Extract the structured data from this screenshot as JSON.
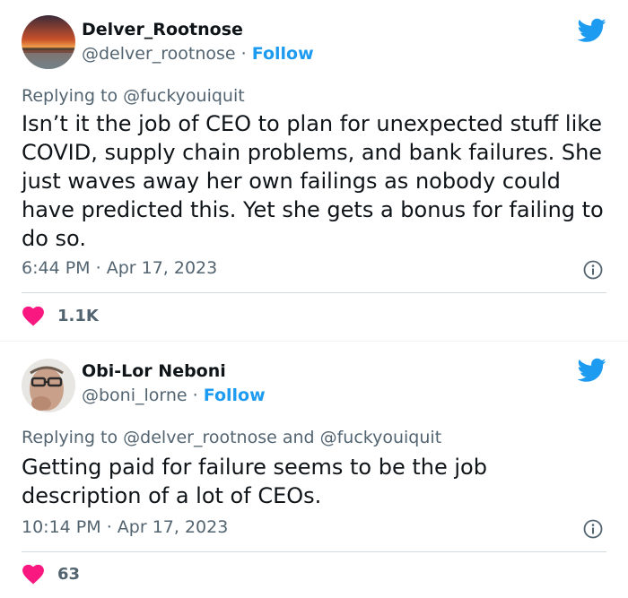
{
  "colors": {
    "accent": "#1d9bf0",
    "heart": "#f91880",
    "text_primary": "#0f1419",
    "text_secondary": "#536471"
  },
  "tweets": [
    {
      "display_name": "Delver_Rootnose",
      "handle": "@delver_rootnose",
      "separator": "·",
      "follow_label": "Follow",
      "replying_prefix": "Replying to",
      "replying_handles": "@fuckyouiquit",
      "text": "Isn’t it the job of CEO to plan for unexpected stuff like COVID, supply chain problems, and bank failures. She just waves away her own failings as nobody could have predicted this. Yet she gets a bonus for failing to do so.",
      "time": "6:44 PM",
      "date": "Apr 17, 2023",
      "likes": "1.1K",
      "avatar_icon": "sunset-avatar",
      "brand_icon": "twitter-bird-icon"
    },
    {
      "display_name": "Obi-Lor Neboni",
      "handle": "@boni_lorne",
      "separator": "·",
      "follow_label": "Follow",
      "replying_prefix": "Replying to",
      "replying_handles": "@delver_rootnose and @fuckyouiquit",
      "text": "Getting paid for failure seems to be the job description of a lot of CEOs.",
      "time": "10:14 PM",
      "date": "Apr 17, 2023",
      "likes": "63",
      "avatar_icon": "person-glasses-avatar",
      "brand_icon": "twitter-bird-icon"
    }
  ]
}
